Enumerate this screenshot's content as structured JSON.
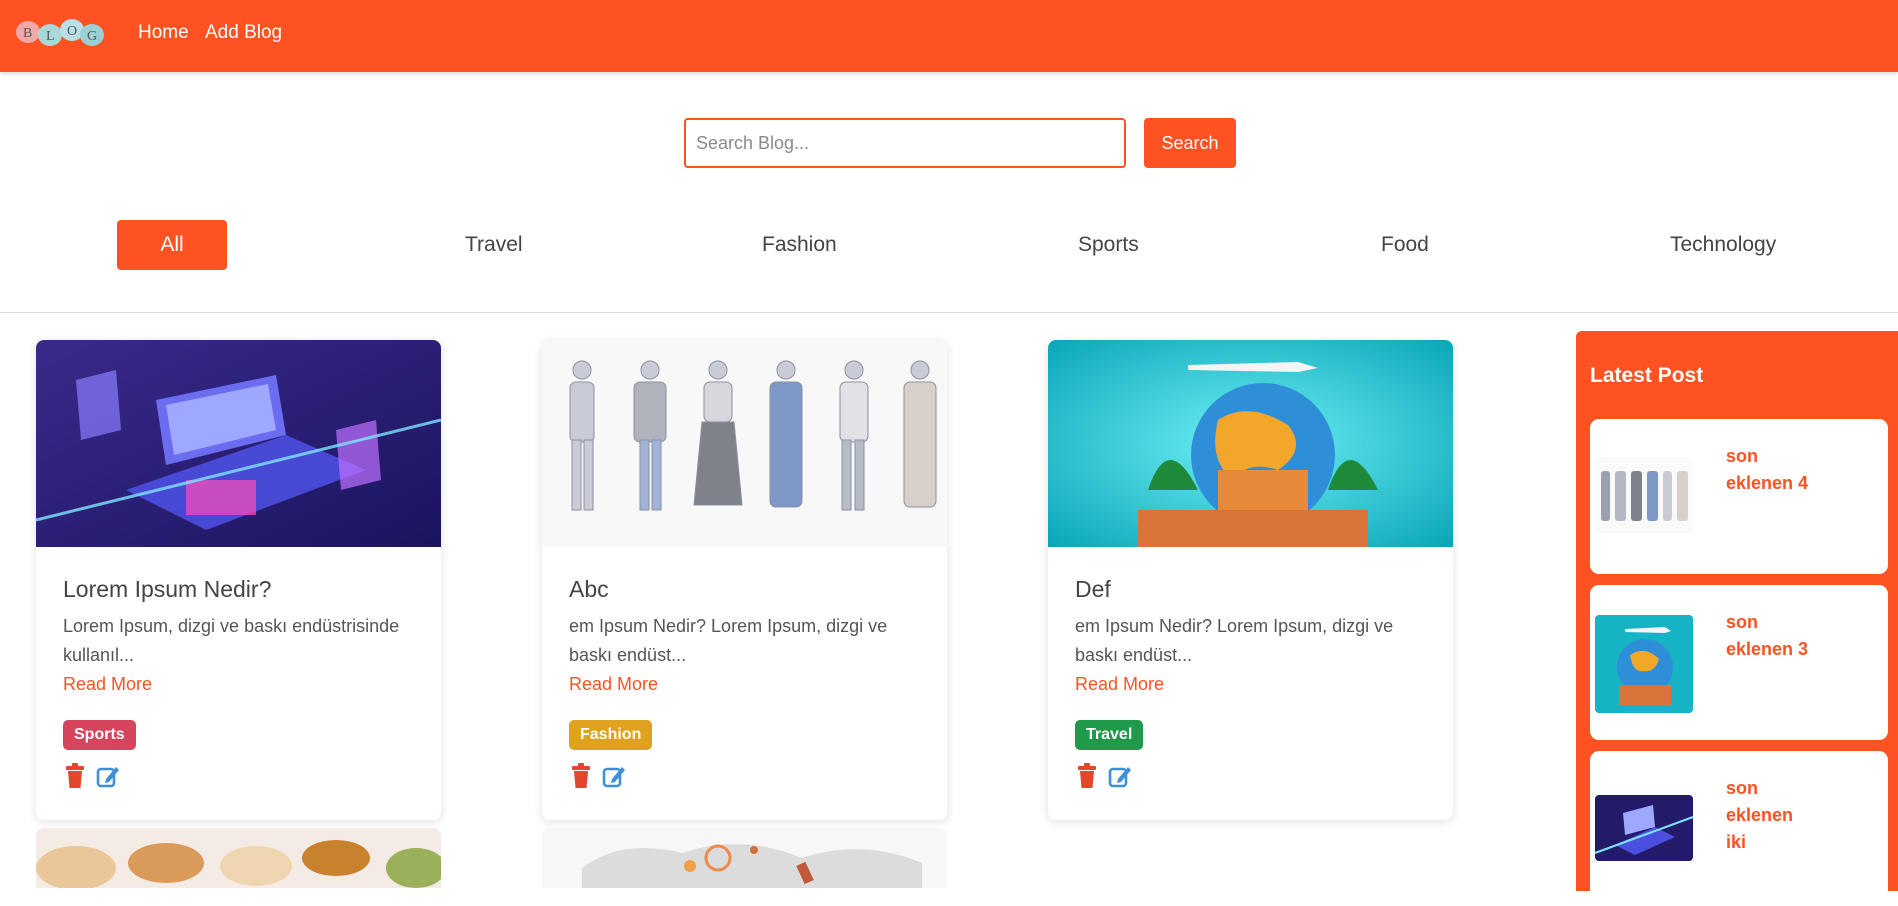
{
  "nav": {
    "logo_letters": [
      "B",
      "L",
      "O",
      "G"
    ],
    "home_label": "Home",
    "add_blog_label": "Add Blog"
  },
  "search": {
    "placeholder": "Search Blog...",
    "button_label": "Search"
  },
  "categories": [
    {
      "label": "All",
      "active": true
    },
    {
      "label": "Travel",
      "active": false
    },
    {
      "label": "Fashion",
      "active": false
    },
    {
      "label": "Sports",
      "active": false
    },
    {
      "label": "Food",
      "active": false
    },
    {
      "label": "Technology",
      "active": false
    }
  ],
  "posts": [
    {
      "title": "Lorem Ipsum Nedir?",
      "excerpt": "Lorem Ipsum, dizgi ve baskı endüstrisinde kullanıl...",
      "read_more": "Read More",
      "category": "Sports",
      "category_color": "#d6445d"
    },
    {
      "title": "Abc",
      "excerpt": "em Ipsum Nedir? Lorem Ipsum, dizgi ve baskı endüst...",
      "read_more": "Read More",
      "category": "Fashion",
      "category_color": "#dea21c"
    },
    {
      "title": "Def",
      "excerpt": "em Ipsum Nedir? Lorem Ipsum, dizgi ve baskı endüst...",
      "read_more": "Read More",
      "category": "Travel",
      "category_color": "#1e9a4a"
    }
  ],
  "sidebar": {
    "title": "Latest Post",
    "items": [
      {
        "label": "son eklenen 4"
      },
      {
        "label": "son eklenen 3"
      },
      {
        "label": "son eklenen iki"
      }
    ]
  },
  "colors": {
    "brand": "#ff5222",
    "delete_icon": "#e2462b",
    "edit_icon": "#3d8fd8"
  }
}
